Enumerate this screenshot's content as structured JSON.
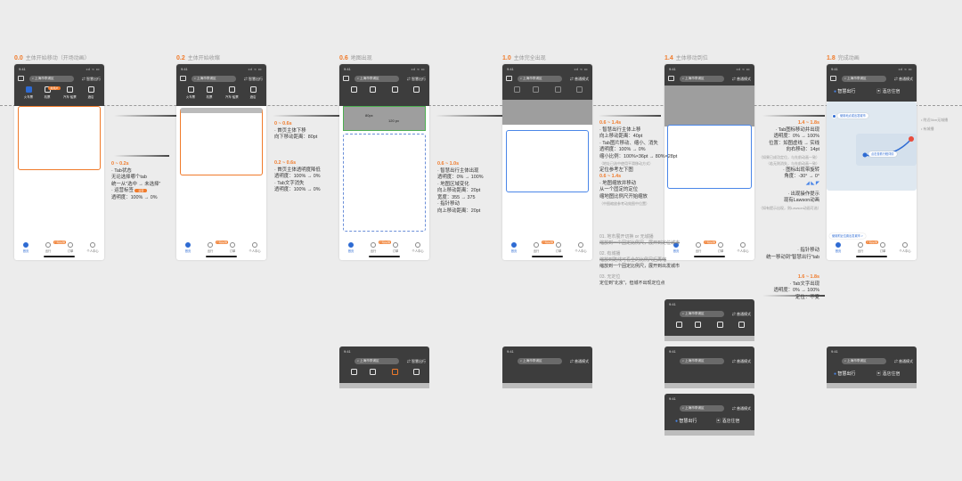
{
  "stages": [
    {
      "num": "0.0",
      "label": "主体开始移动（开场动画）"
    },
    {
      "num": "0.2",
      "label": "主体开始收缩"
    },
    {
      "num": "0.6",
      "label": "地图出现"
    },
    {
      "num": "1.0",
      "label": "主体完全出现"
    },
    {
      "num": "1.4",
      "label": "主体移动到位"
    },
    {
      "num": "1.8",
      "label": "完成动画"
    }
  ],
  "phone": {
    "time": "9:41",
    "signal": "••l ≈ ▭",
    "search_placeholder": "上海市李浦区",
    "mode_label": "智慧出行",
    "mode_label_alt": "普通模式",
    "tabs": [
      "火车票",
      "机票",
      "汽车·船票",
      "酒店"
    ],
    "tab_badge": "新用户",
    "tabbar": [
      "首页",
      "出行",
      "订单",
      "个人中心"
    ],
    "tabbar_badge": "行程提醒"
  },
  "annotations": {
    "a1": {
      "time": "0 ~ 0.2s",
      "lines": [
        "· Tab状态",
        "无论选择哪个tab",
        "统一从\"选中 → 未选择\"",
        "· 运营标签",
        "透明度：100% → 0%"
      ],
      "tag": "运营"
    },
    "a2": {
      "time": "0 ~ 0.6s",
      "lines": [
        "· 首页主体下移",
        "向下移动距离：80pt"
      ]
    },
    "a3": {
      "time": "0.2 ~ 0.6s",
      "lines": [
        "· 首页主体透明度降低",
        "透明度：100% → 0%",
        "· Tab文字消失",
        "透明度：100% → 0%"
      ]
    },
    "a4": {
      "time": "0.6 ~ 1.0s",
      "lines": [
        "· 智慧出行主体出现",
        "透明度：0% → 100%",
        "· 地图区域变化",
        "向上移动距离：20pt",
        "宽度：355 → 375",
        "· 指针移动",
        "向上移动距离：20pt"
      ]
    },
    "a5": {
      "time": "0.6 ~ 1.4s",
      "lines": [
        "· 智慧出行主体上移",
        "向上移动距离：40pt",
        "· Tab图片移动、缩小、消失",
        "透明度：100% → 0%",
        "缩小比例：100%×36pt → 80%×28pt",
        "（地址已选中使用平滑移动方式）",
        "定位参考左下图",
        "· 地图缩放并移动",
        "从一个固定的定位",
        "缩地图比例尺开始缩放",
        "（中图缩放参考动效图中位置）"
      ]
    },
    "a5b": {
      "time": "0.6 ~ 1.4s"
    },
    "a5c": {
      "lines": [
        "01. 地市展开切换 or 无城播",
        "缩放到一个固定比例尺，展开到定位城市",
        "02. 有城播",
        "缩放到路线可看全的比例尺后再缩",
        "缩放到一个固定比例尺，展开到出发城市",
        "03. 无定位",
        "定位到\"北京\"，但城不出现定位点"
      ]
    },
    "a6": {
      "time": "1.4 ~ 1.8s",
      "lines": [
        "· Tab图标移动并出现",
        "透明度：0% → 100%",
        "位置：如图虚线 → 实线",
        "向右移动：14pt",
        "（如果已成功定位，与先前动画一致）",
        "（若无则消失，与先前动画一致）",
        "· 图标出现带旋转",
        "角度：-30° → 0°",
        "· 出现操作提示",
        "现有Lawson动画",
        "（如有提示出现，则Lawson动画可选）",
        "· 指针移动",
        "统一移动到\"智慧出行\"tab"
      ]
    },
    "a7": {
      "time": "1.6 ~ 1.8s",
      "lines": [
        "· Tab文字出现",
        "透明度：0% → 100%",
        "定位：不变"
      ]
    }
  },
  "mid": {
    "label1": "80px",
    "label2": "120 px"
  },
  "final": {
    "tab_left": "智慧出行",
    "tab_right": "酒店住宿",
    "chip1": "使用地点或出发城市",
    "chip2": "点击查看行程详情",
    "chip3": "使用附近位置出发城市 >",
    "side1": "• 附近5km无城播",
    "side2": "• 有城播"
  }
}
